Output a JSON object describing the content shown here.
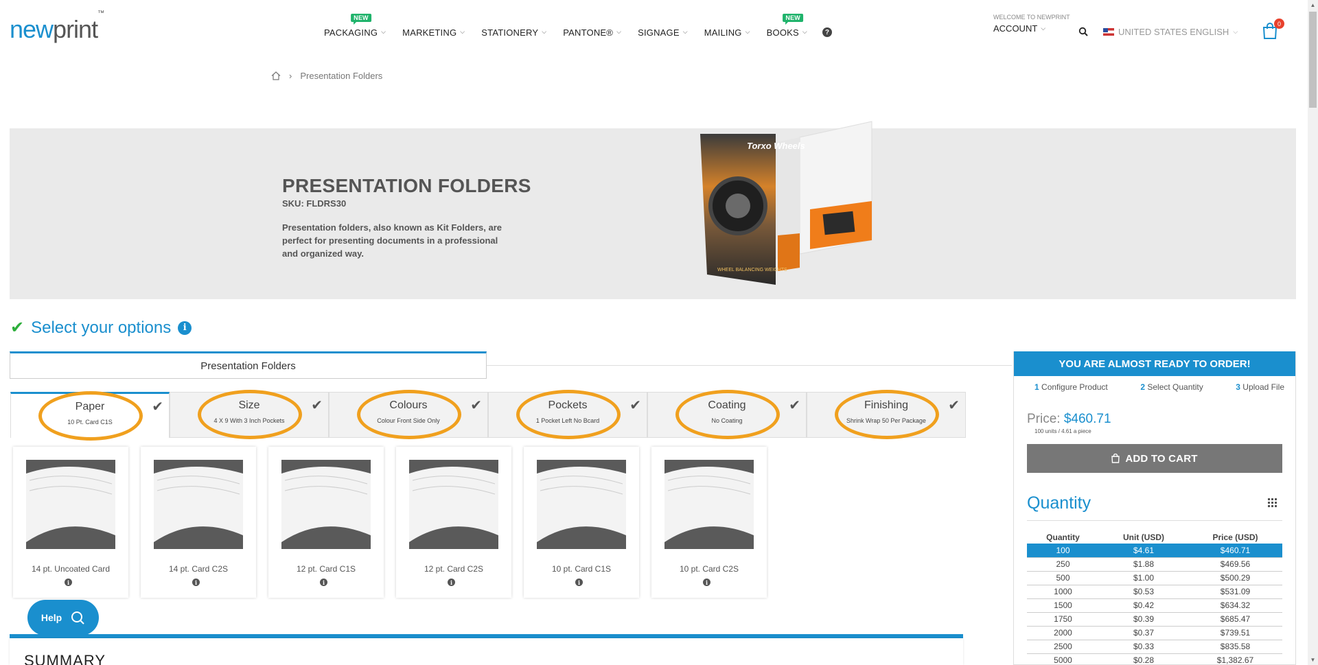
{
  "header": {
    "logo_new": "new",
    "logo_print": "print",
    "logo_tm": "™",
    "nav": [
      {
        "label": "PACKAGING",
        "new": true
      },
      {
        "label": "MARKETING",
        "new": false
      },
      {
        "label": "STATIONERY",
        "new": false
      },
      {
        "label": "PANTONE®",
        "new": false
      },
      {
        "label": "SIGNAGE",
        "new": false
      },
      {
        "label": "MAILING",
        "new": false
      },
      {
        "label": "BOOKS",
        "new": true
      }
    ],
    "new_badge": "NEW",
    "welcome": "WELCOME TO NEWPRINT",
    "account": "ACCOUNT",
    "language": "UNITED STATES ENGLISH",
    "cart_count": "0"
  },
  "breadcrumb": {
    "current": "Presentation Folders"
  },
  "hero": {
    "title": "PRESENTATION FOLDERS",
    "sku": "SKU: FLDRS30",
    "description": "Presentation folders, also known as Kit Folders, are perfect for presenting documents in a professional and organized way.",
    "image_brand": "Torxo Wheels",
    "image_tagline": "WHEEL BALANCING WEIGHTS"
  },
  "options": {
    "heading": "Select your options",
    "product_tab": "Presentation Folders",
    "tabs": [
      {
        "label": "Paper",
        "value": "10 Pt. Card C1S"
      },
      {
        "label": "Size",
        "value": "4 X 9 With 3 Inch Pockets"
      },
      {
        "label": "Colours",
        "value": "Colour Front Side Only"
      },
      {
        "label": "Pockets",
        "value": "1 Pocket Left No Bcard"
      },
      {
        "label": "Coating",
        "value": "No Coating"
      },
      {
        "label": "Finishing",
        "value": "Shrink Wrap 50 Per Package"
      }
    ],
    "papers": [
      "14 pt. Uncoated Card",
      "14 pt. Card C2S",
      "12 pt. Card C1S",
      "12 pt. Card C2S",
      "10 pt. Card C1S",
      "10 pt. Card C2S"
    ]
  },
  "help": "Help",
  "summary": "SUMMARY",
  "panel": {
    "banner": "YOU ARE ALMOST READY TO ORDER!",
    "steps": [
      {
        "num": "1",
        "label": "Configure Product"
      },
      {
        "num": "2",
        "label": "Select Quantity"
      },
      {
        "num": "3",
        "label": "Upload File"
      }
    ],
    "price_label": "Price:",
    "price_value": "$460.71",
    "price_sub": "100 units / 4.61 a piece",
    "add_to_cart": "ADD TO CART",
    "quantity_title": "Quantity",
    "columns": [
      "Quantity",
      "Unit (USD)",
      "Price (USD)"
    ],
    "rows": [
      [
        "100",
        "$4.61",
        "$460.71"
      ],
      [
        "250",
        "$1.88",
        "$469.56"
      ],
      [
        "500",
        "$1.00",
        "$500.29"
      ],
      [
        "1000",
        "$0.53",
        "$531.09"
      ],
      [
        "1500",
        "$0.42",
        "$634.32"
      ],
      [
        "1750",
        "$0.39",
        "$685.47"
      ],
      [
        "2000",
        "$0.37",
        "$739.51"
      ],
      [
        "2500",
        "$0.33",
        "$835.58"
      ],
      [
        "5000",
        "$0.28",
        "$1,382.67"
      ]
    ]
  },
  "colors": {
    "accent": "#1a8fce",
    "highlight_ring": "#f0a01e",
    "new_badge": "#1fb36b"
  }
}
